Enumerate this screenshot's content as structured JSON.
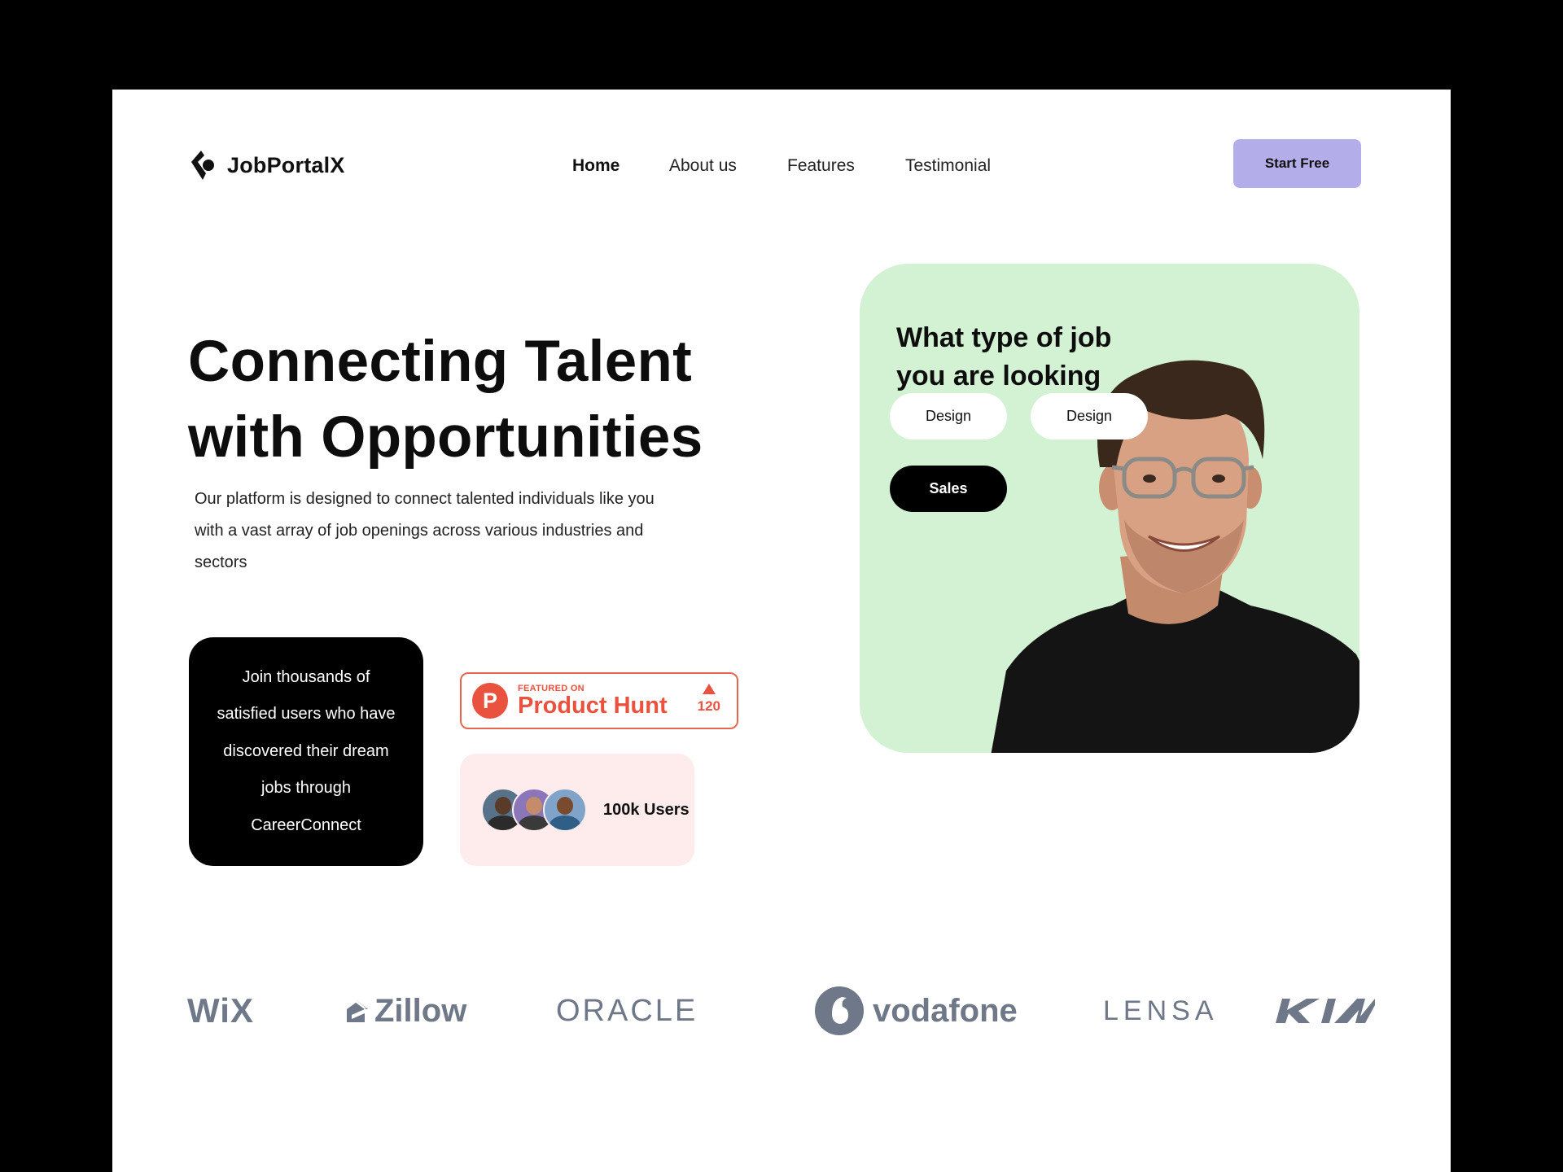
{
  "brand": {
    "name": "JobPortalX",
    "logo_icon": "jobportalx-logo-icon"
  },
  "nav": {
    "items": [
      {
        "label": "Home",
        "active": true
      },
      {
        "label": "About us",
        "active": false
      },
      {
        "label": "Features",
        "active": false
      },
      {
        "label": "Testimonial",
        "active": false
      }
    ],
    "cta_label": "Start Free"
  },
  "hero": {
    "title_line1": "Connecting Talent",
    "title_line2": "with Opportunities",
    "subtitle_line1": "Our platform is designed to connect talented individuals like you",
    "subtitle_line2": "with a vast array of job openings across various industries and",
    "subtitle_line3": "sectors"
  },
  "join_card": {
    "line1": "Join thousands of",
    "line2": "satisfied users who have",
    "line3": "discovered their dream",
    "line4": "jobs through",
    "line5": "CareerConnect"
  },
  "product_hunt": {
    "featured_label": "FEATURED ON",
    "name": "Product Hunt",
    "logo_letter": "P",
    "votes": "120"
  },
  "users_card": {
    "label": "100k Users"
  },
  "job_card": {
    "question_line1": "What type of job",
    "question_line2": "you are looking",
    "options": [
      {
        "label": "Design",
        "selected": false
      },
      {
        "label": "Design",
        "selected": false
      },
      {
        "label": "Sales",
        "selected": true
      }
    ]
  },
  "logos": {
    "wix": "WiX",
    "zillow": "Zillow",
    "oracle": "ORACLE",
    "vodafone": "vodafone",
    "lensa": "LENSA",
    "kia": "KIA"
  },
  "colors": {
    "accent_button": "#b3aee9",
    "job_card_bg": "#d3f1d3",
    "product_hunt": "#e8523f",
    "users_card_bg": "#fdeceb",
    "logo_gray": "#6f7889"
  }
}
